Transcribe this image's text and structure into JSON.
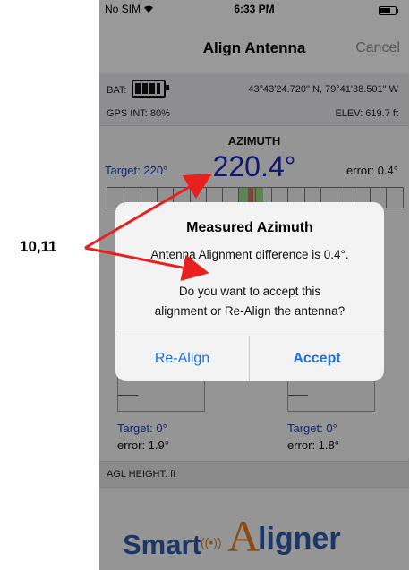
{
  "annotation": {
    "label": "10,11",
    "arrow_color": "#e8201e"
  },
  "status_bar": {
    "carrier": "No SIM",
    "wifi_icon": "wifi-icon",
    "time": "6:33 PM",
    "battery_icon": "battery-icon",
    "battery_level": 0.7
  },
  "nav": {
    "title": "Align Antenna",
    "cancel_label": "Cancel"
  },
  "info": {
    "bat_label": "BAT:",
    "bat_icon": "battery-gauge-icon",
    "gps_coords": "43°43'24.720\" N,  79°41'38.501\" W",
    "gps_int": "GPS INT:  80%",
    "elev": "ELEV:  619.7 ft"
  },
  "azimuth": {
    "title": "AZIMUTH",
    "target": "Target: 220°",
    "value": "220.4°",
    "error": "error: 0.4°"
  },
  "lower": {
    "left": {
      "target": "Target: 0°",
      "error": "error: 1.9°"
    },
    "right": {
      "target": "Target: 0°",
      "error": "error: 1.8°"
    }
  },
  "agl": {
    "label": "AGL HEIGHT:  ft"
  },
  "logo": {
    "smart": "Smart",
    "a": "A",
    "ligner": "ligner",
    "waves": "((•))"
  },
  "alert": {
    "title": "Measured Azimuth",
    "line1": "Antenna Alignment difference is 0.4°.",
    "line2": "Do you want to accept this",
    "line3": "alignment or Re-Align the antenna?",
    "realign_label": "Re-Align",
    "accept_label": "Accept"
  },
  "colors": {
    "accent_blue": "#1f6fe0",
    "azimuth_blue": "#1a28b8",
    "logo_orange": "#e07a22",
    "logo_blue": "#2b5aa8"
  }
}
